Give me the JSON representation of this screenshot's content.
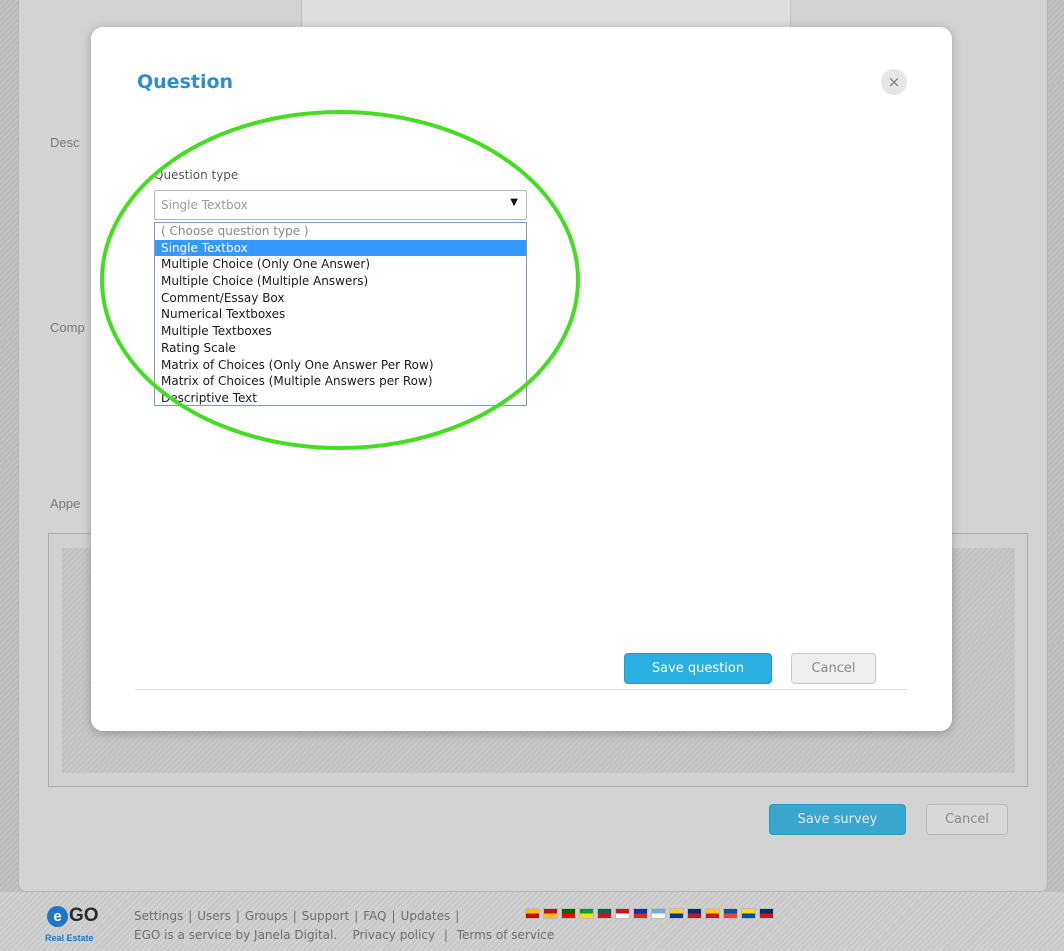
{
  "background": {
    "labels": {
      "description": "Desc",
      "company": "Comp",
      "appearance": "Appe"
    },
    "save_survey_label": "Save survey",
    "cancel_label": "Cancel"
  },
  "modal": {
    "title": "Question",
    "close_glyph": "×",
    "question_type_label": "Question type",
    "select_value": "Single Textbox",
    "select_arrow": "▼",
    "options": [
      "( Choose question type )",
      "Single Textbox",
      "Multiple Choice (Only One Answer)",
      "Multiple Choice (Multiple Answers)",
      "Comment/Essay Box",
      "Numerical Textboxes",
      "Multiple Textboxes",
      "Rating Scale",
      "Matrix of Choices (Only One Answer Per Row)",
      "Matrix of Choices (Multiple Answers per Row)",
      "Descriptive Text"
    ],
    "selected_option": "Single Textbox",
    "save_label": "Save question",
    "cancel_label": "Cancel",
    "annotation_color": "#44dd22"
  },
  "footer": {
    "logo_mark": "e",
    "logo_text": "GO",
    "logo_sub": "Real Estate",
    "links": [
      "Settings",
      "Users",
      "Groups",
      "Support",
      "FAQ",
      "Updates"
    ],
    "separator": "|",
    "line2_text": "EGO is a service by Janela Digital.",
    "privacy_label": "Privacy policy",
    "terms_label": "Terms of service",
    "flags": [
      {
        "name": "catalonia",
        "colors": [
          "#f4c400",
          "#d40000"
        ]
      },
      {
        "name": "spain",
        "colors": [
          "#c60b1e",
          "#ffc400"
        ]
      },
      {
        "name": "portugal",
        "colors": [
          "#006600",
          "#ff0000"
        ]
      },
      {
        "name": "brazil",
        "colors": [
          "#009c3b",
          "#ffdf00"
        ]
      },
      {
        "name": "mexico",
        "colors": [
          "#006847",
          "#ce1126"
        ]
      },
      {
        "name": "peru",
        "colors": [
          "#d91023",
          "#ffffff"
        ]
      },
      {
        "name": "chile",
        "colors": [
          "#0039a6",
          "#d52b1e"
        ]
      },
      {
        "name": "argentina",
        "colors": [
          "#74acdf",
          "#ffffff"
        ]
      },
      {
        "name": "colombia",
        "colors": [
          "#fcd116",
          "#003893"
        ]
      },
      {
        "name": "costa-rica",
        "colors": [
          "#002b7f",
          "#ce1126"
        ]
      },
      {
        "name": "venezuela",
        "colors": [
          "#ffcc00",
          "#cf142b"
        ]
      },
      {
        "name": "france",
        "colors": [
          "#0055a4",
          "#ef4135"
        ]
      },
      {
        "name": "ecuador",
        "colors": [
          "#ffdd00",
          "#034ea2"
        ]
      },
      {
        "name": "dominican-republic",
        "colors": [
          "#002d62",
          "#ce1126"
        ]
      }
    ]
  }
}
